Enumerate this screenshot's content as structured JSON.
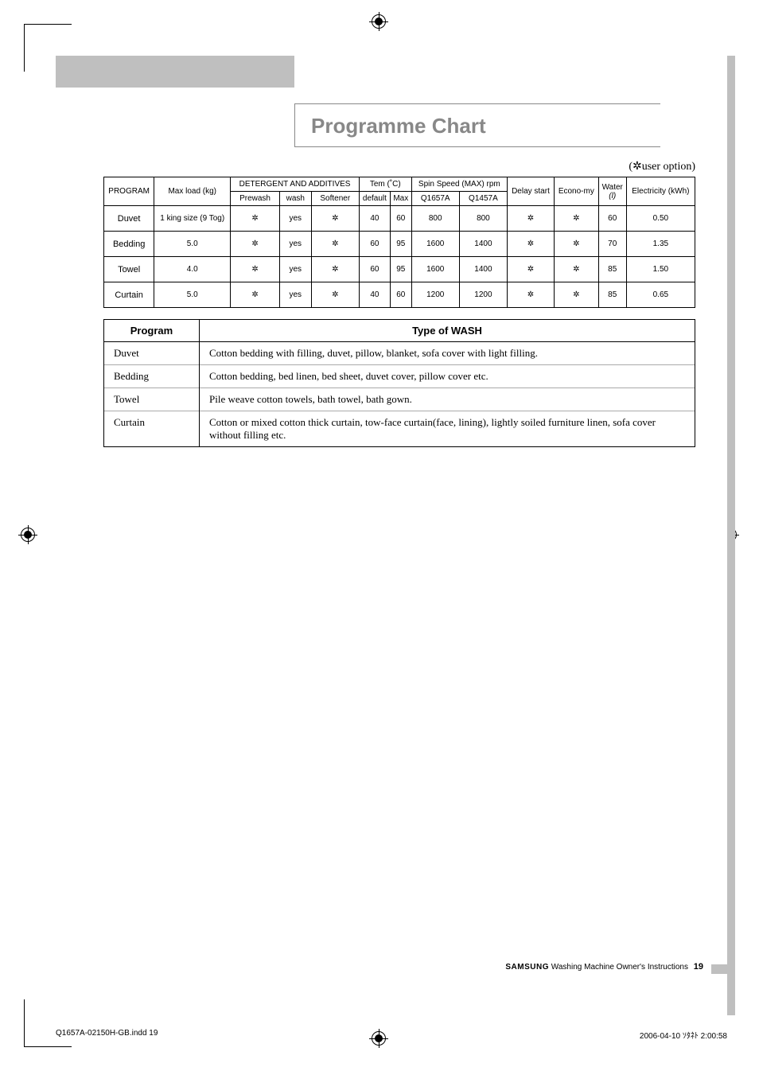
{
  "title": "Programme Chart",
  "user_option_note": "(   user option)",
  "star": "✲",
  "table1": {
    "headers": {
      "program": "PROGRAM",
      "maxload": "Max load (kg)",
      "detergent": "DETERGENT AND ADDITIVES",
      "tem": "Tem (˚C)",
      "spin": "Spin Speed (MAX) rpm",
      "delay": "Delay start",
      "economy": "Econo-my",
      "water": "Water (l)",
      "electricity": "Electricity (kWh)",
      "sub": {
        "prewash": "Prewash",
        "wash": "wash",
        "softener": "Softener",
        "default": "default",
        "max": "Max",
        "q1657a": "Q1657A",
        "q1457a": "Q1457A"
      }
    },
    "rows": [
      {
        "program": "Duvet",
        "maxload": "1 king size (9 Tog)",
        "prewash": "✲",
        "wash": "yes",
        "softener": "✲",
        "tem_def": "40",
        "tem_max": "60",
        "spin_a": "800",
        "spin_b": "800",
        "delay": "✲",
        "eco": "✲",
        "water": "60",
        "elec": "0.50"
      },
      {
        "program": "Bedding",
        "maxload": "5.0",
        "prewash": "✲",
        "wash": "yes",
        "softener": "✲",
        "tem_def": "60",
        "tem_max": "95",
        "spin_a": "1600",
        "spin_b": "1400",
        "delay": "✲",
        "eco": "✲",
        "water": "70",
        "elec": "1.35"
      },
      {
        "program": "Towel",
        "maxload": "4.0",
        "prewash": "✲",
        "wash": "yes",
        "softener": "✲",
        "tem_def": "60",
        "tem_max": "95",
        "spin_a": "1600",
        "spin_b": "1400",
        "delay": "✲",
        "eco": "✲",
        "water": "85",
        "elec": "1.50"
      },
      {
        "program": "Curtain",
        "maxload": "5.0",
        "prewash": "✲",
        "wash": "yes",
        "softener": "✲",
        "tem_def": "40",
        "tem_max": "60",
        "spin_a": "1200",
        "spin_b": "1200",
        "delay": "✲",
        "eco": "✲",
        "water": "85",
        "elec": "0.65"
      }
    ]
  },
  "table2": {
    "headers": {
      "program": "Program",
      "type": "Type of WASH"
    },
    "rows": [
      {
        "program": "Duvet",
        "type": "Cotton bedding with filling, duvet, pillow, blanket, sofa cover with light filling."
      },
      {
        "program": "Bedding",
        "type": "Cotton bedding, bed linen, bed sheet, duvet cover, pillow cover etc."
      },
      {
        "program": "Towel",
        "type": "Pile weave cotton towels, bath towel, bath gown."
      },
      {
        "program": "Curtain",
        "type": "Cotton or mixed cotton thick curtain, tow-face curtain(face, lining), lightly soiled furniture linen, sofa cover without filling etc."
      }
    ]
  },
  "footer": {
    "brand": "SAMSUNG",
    "text": "Washing Machine Owner's Instructions",
    "page": "19"
  },
  "print": {
    "left": "Q1657A-02150H-GB.indd   19",
    "right": "2006-04-10   ｿﾀﾈﾄ 2:00:58"
  },
  "chart_data": {
    "type": "table",
    "title": "Programme Chart",
    "columns": [
      "PROGRAM",
      "Max load (kg)",
      "Prewash",
      "wash",
      "Softener",
      "Tem default (°C)",
      "Tem Max (°C)",
      "Spin Q1657A (rpm)",
      "Spin Q1457A (rpm)",
      "Delay start",
      "Economy",
      "Water (l)",
      "Electricity (kWh)"
    ],
    "rows": [
      [
        "Duvet",
        "1 king size (9 Tog)",
        "user option",
        "yes",
        "user option",
        40,
        60,
        800,
        800,
        "user option",
        "user option",
        60,
        0.5
      ],
      [
        "Bedding",
        5.0,
        "user option",
        "yes",
        "user option",
        60,
        95,
        1600,
        1400,
        "user option",
        "user option",
        70,
        1.35
      ],
      [
        "Towel",
        4.0,
        "user option",
        "yes",
        "user option",
        60,
        95,
        1600,
        1400,
        "user option",
        "user option",
        85,
        1.5
      ],
      [
        "Curtain",
        5.0,
        "user option",
        "yes",
        "user option",
        40,
        60,
        1200,
        1200,
        "user option",
        "user option",
        85,
        0.65
      ]
    ]
  }
}
